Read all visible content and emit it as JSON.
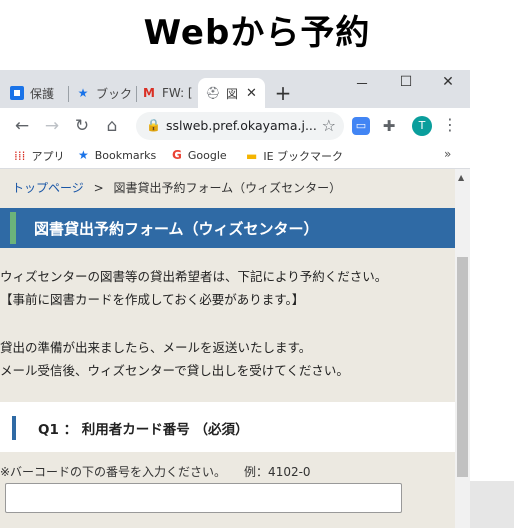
{
  "caption": "Webから予約",
  "tabs": [
    {
      "label": "保護",
      "icon": "shield-tab-icon",
      "color": "#1a73e8"
    },
    {
      "label": "ブック",
      "icon": "star-tab-icon",
      "color": "#1a73e8"
    },
    {
      "label": "FW: [",
      "icon": "gmail-icon",
      "color": "#d93025"
    },
    {
      "label": "図",
      "icon": "graduation-cap-icon",
      "color": "#5f6368"
    }
  ],
  "window_controls": {
    "minimize": "－",
    "maximize": "☐",
    "close": "✕"
  },
  "toolbar": {
    "url": "sslweb.pref.okayama.j...",
    "avatar_letter": "T"
  },
  "bookmarks": [
    {
      "label": "アプリ",
      "icon": "apps-grid-icon"
    },
    {
      "label": "Bookmarks",
      "icon": "star-icon"
    },
    {
      "label": "Google",
      "icon": "google-icon"
    },
    {
      "label": "IE ブックマーク",
      "icon": "folder-icon"
    }
  ],
  "page": {
    "breadcrumb_home": "トップページ",
    "breadcrumb_sep": ">",
    "breadcrumb_current": "図書貸出予約フォーム（ウィズセンター）",
    "title": "図書貸出予約フォーム（ウィズセンター）",
    "intro_line1": "ウィズセンターの図書等の貸出希望者は、下記により予約ください。",
    "intro_line2": "【事前に図書カードを作成しておく必要があります。】",
    "intro_line3": "貸出の準備が出来ましたら、メールを返送いたします。",
    "intro_line4": "メール受信後、ウィズセンターで貸し出しを受けてください。",
    "q1_label": "Q1 ： 利用者カード番号 （必須）",
    "q1_hint": "※バーコードの下の番号を入力ください。　　例：4102-0",
    "q1_value": ""
  },
  "colors": {
    "title_bar": "#2f6aa5",
    "title_accent": "#6bb37a",
    "content_bg": "#ece9e1",
    "link": "#1a56a6"
  }
}
